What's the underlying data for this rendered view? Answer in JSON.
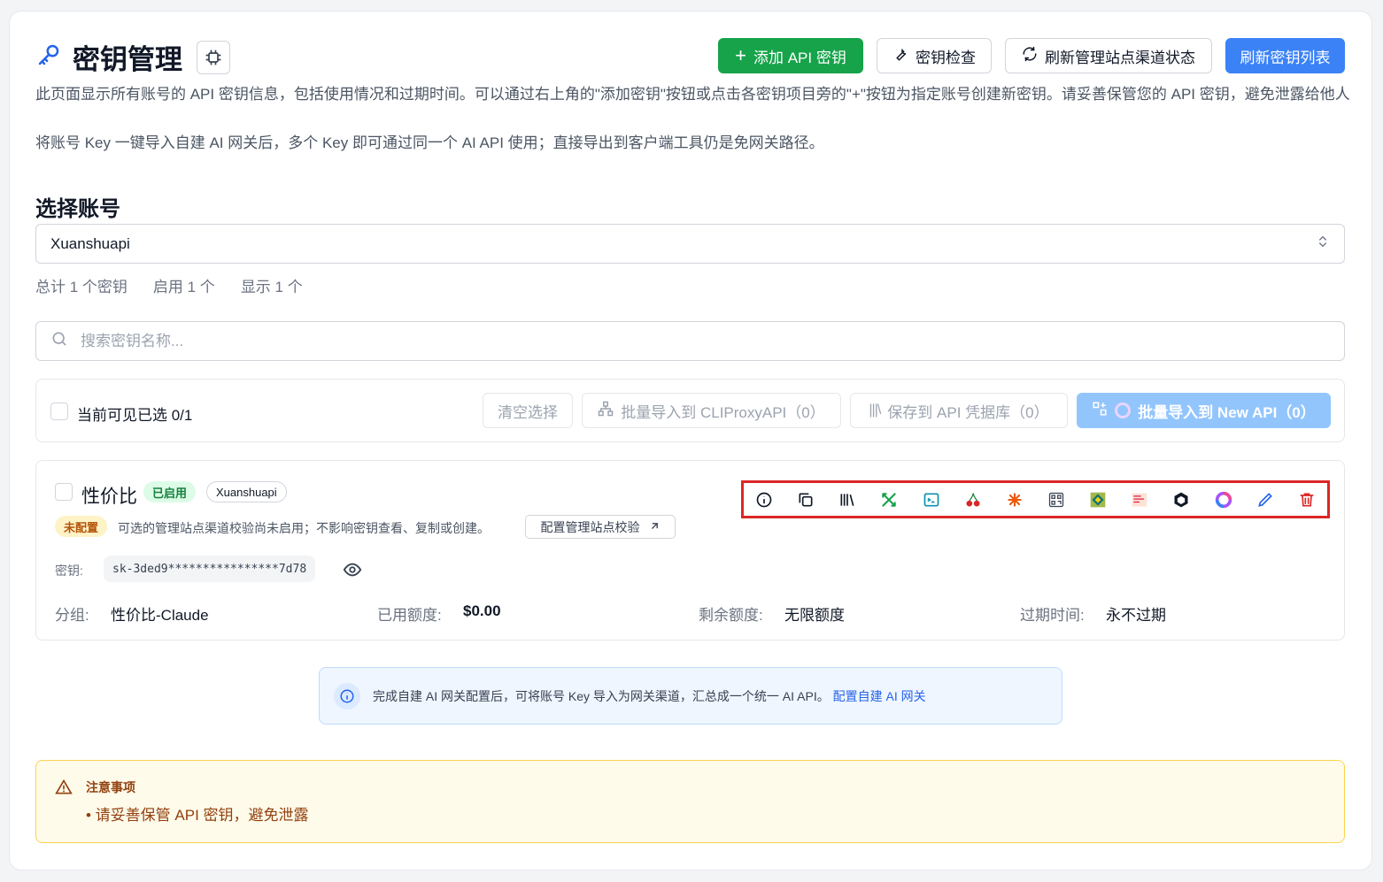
{
  "header": {
    "title": "密钥管理",
    "add_button": "添加 API 密钥",
    "check_button": "密钥检查",
    "refresh_status_button": "刷新管理站点渠道状态",
    "refresh_list_button": "刷新密钥列表"
  },
  "description": {
    "line1": "此页面显示所有账号的 API 密钥信息，包括使用情况和过期时间。可以通过右上角的\"添加密钥\"按钮或点击各密钥项目旁的\"+\"按钮为指定账号创建新密钥。请妥善保管您的 API 密钥，避免泄露给他人",
    "line2": "将账号 Key 一键导入自建 AI 网关后，多个 Key 即可通过同一个 AI API 使用；直接导出到客户端工具仍是免网关路径。"
  },
  "account": {
    "heading": "选择账号",
    "selected": "Xuanshuapi",
    "stat_total": "总计 1 个密钥",
    "stat_enabled": "启用 1 个",
    "stat_shown": "显示 1 个"
  },
  "search": {
    "placeholder": "搜索密钥名称..."
  },
  "bulk": {
    "selected_label": "当前可见已选 0/1",
    "clear": "清空选择",
    "import_cliproxy": "批量导入到 CLIProxyAPI（0）",
    "save_vault": "保存到 API 凭据库（0）",
    "import_newapi": "批量导入到 New API（0）"
  },
  "key_item": {
    "name": "性价比",
    "status_badge": "已启用",
    "account_badge": "Xuanshuapi",
    "config_badge": "未配置",
    "config_note": "可选的管理站点渠道校验尚未启用；不影响密钥查看、复制或创建。",
    "config_button": "配置管理站点校验",
    "key_label": "密钥:",
    "key_value": "sk-3ded9****************7d78",
    "group_label": "分组:",
    "group_value": "性价比-Claude",
    "used_label": "已用额度:",
    "used_value": "$0.00",
    "remaining_label": "剩余额度:",
    "remaining_value": "无限额度",
    "expire_label": "过期时间:",
    "expire_value": "永不过期",
    "action_icons": [
      "info-icon",
      "copy-icon",
      "library-icon",
      "tools-icon",
      "terminal-icon",
      "cherry-icon",
      "sunburst-icon",
      "qr-icon",
      "cube-colorful-icon",
      "gradient-icon",
      "box-icon",
      "ring-icon",
      "pencil-icon",
      "trash-icon"
    ]
  },
  "info_banner": {
    "text": "完成自建 AI 网关配置后，可将账号 Key 导入为网关渠道，汇总成一个统一 AI API。",
    "link": "配置自建 AI 网关"
  },
  "notice": {
    "title": "注意事项",
    "item": "• 请妥善保管 API 密钥，避免泄露"
  },
  "colors": {
    "primary": "#3b82f6",
    "success": "#16a34a",
    "danger": "#dc2626",
    "warning_bg": "#fffbeb"
  }
}
